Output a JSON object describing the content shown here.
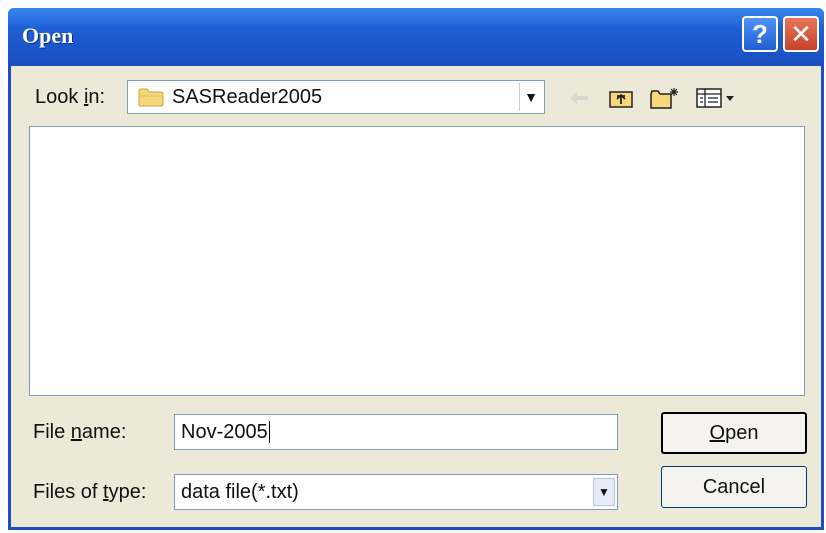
{
  "window": {
    "title": "Open",
    "help_glyph": "?",
    "close_glyph": "✕"
  },
  "lookin": {
    "label_prefix": "Look ",
    "label_mnemonic": "i",
    "label_suffix": "n:",
    "value": "SASReader2005"
  },
  "toolbar": {
    "icons": [
      "back-arrow-icon",
      "up-one-level-icon",
      "new-folder-icon",
      "view-menu-icon"
    ]
  },
  "filename": {
    "label_prefix": "File ",
    "label_mnemonic": "n",
    "label_suffix": "ame:",
    "value": "Nov-2005"
  },
  "filetype": {
    "label_prefix": "Files of ",
    "label_mnemonic": "t",
    "label_suffix": "ype:",
    "value": "data file(*.txt)"
  },
  "buttons": {
    "open_mnemonic": "O",
    "open_rest": "pen",
    "cancel": "Cancel"
  },
  "colors": {
    "titlebar": "#1f5fd6",
    "dialog_bg": "#ece9d8",
    "close_button": "#c8412a"
  }
}
